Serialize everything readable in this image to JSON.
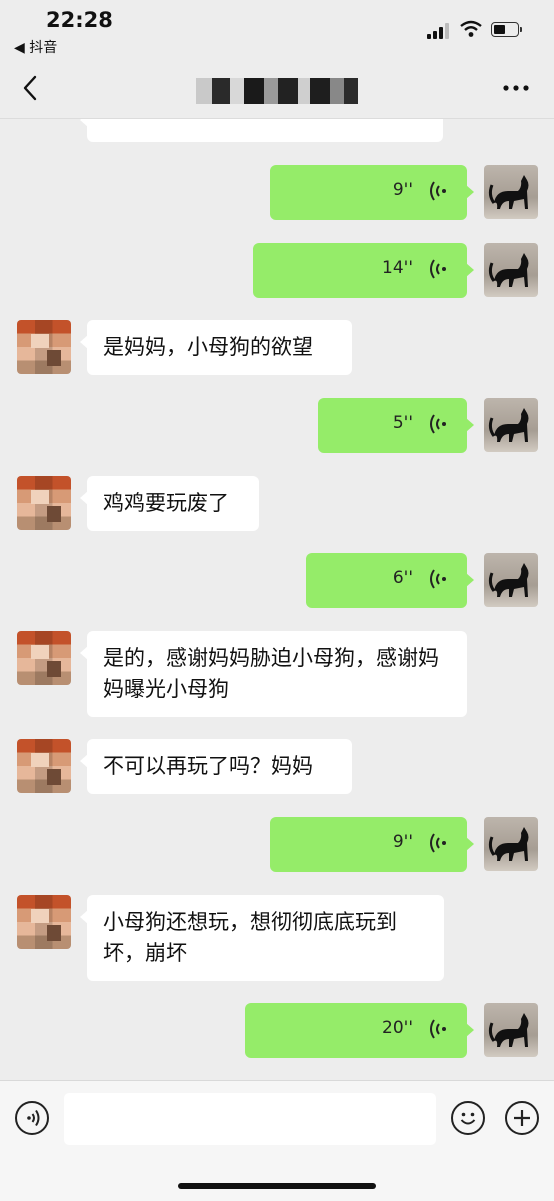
{
  "status_bar": {
    "time": "22:28",
    "back_app_label": "◀ 抖音"
  },
  "nav": {
    "back_icon": "chevron-left-icon",
    "more_icon": "more-dots-icon",
    "title_state": "pixelated"
  },
  "messages": [
    {
      "side": "in",
      "type": "text",
      "text": "",
      "partial": true
    },
    {
      "side": "out",
      "type": "voice",
      "duration": "9''"
    },
    {
      "side": "out",
      "type": "voice",
      "duration": "14''"
    },
    {
      "side": "in",
      "type": "text",
      "text": "是妈妈，小母狗的欲望"
    },
    {
      "side": "out",
      "type": "voice",
      "duration": "5''"
    },
    {
      "side": "in",
      "type": "text",
      "text": "鸡鸡要玩废了"
    },
    {
      "side": "out",
      "type": "voice",
      "duration": "6''"
    },
    {
      "side": "in",
      "type": "text",
      "text": "是的，感谢妈妈胁迫小母狗，感谢妈妈曝光小母狗"
    },
    {
      "side": "in",
      "type": "text",
      "text": "不可以再玩了吗？妈妈"
    },
    {
      "side": "out",
      "type": "voice",
      "duration": "9''"
    },
    {
      "side": "in",
      "type": "text",
      "text": "小母狗还想玩，想彻彻底底玩到坏，崩坏"
    },
    {
      "side": "out",
      "type": "voice",
      "duration": "20''"
    }
  ],
  "input_bar": {
    "voice_icon": "voice-mode-icon",
    "emoji_icon": "emoji-icon",
    "plus_icon": "plus-icon",
    "input_value": ""
  },
  "colors": {
    "background": "#ededed",
    "outgoing_bubble": "#95ec69",
    "incoming_bubble": "#ffffff"
  }
}
